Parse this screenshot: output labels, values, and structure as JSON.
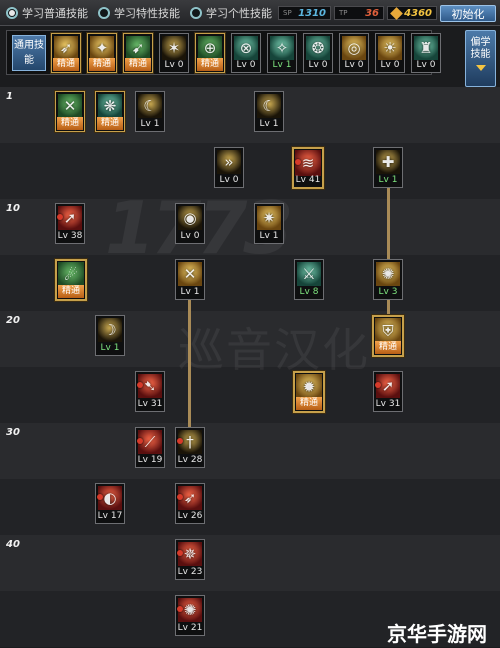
{
  "topbar": {
    "tabs": [
      {
        "label": "学习普通技能",
        "selected": true
      },
      {
        "label": "学习特性技能",
        "selected": false
      },
      {
        "label": "学习个性技能",
        "selected": false
      }
    ],
    "counters": [
      {
        "icon": "sp-icon",
        "value": "1310"
      },
      {
        "icon": "tp-icon",
        "value": "36"
      },
      {
        "icon": "qp-gem-icon",
        "value": "4360"
      }
    ],
    "reset_label": "初始化"
  },
  "common_skills": {
    "label": "通用技能",
    "slots": [
      {
        "text": "精通",
        "mastery": true,
        "glyph": "➶",
        "tone": "t-gold"
      },
      {
        "text": "精通",
        "mastery": true,
        "glyph": "✦",
        "tone": "t-gold"
      },
      {
        "text": "精通",
        "mastery": true,
        "glyph": "➹",
        "tone": "t-green"
      },
      {
        "text": "Lv 0",
        "mastery": false,
        "glyph": "✶",
        "tone": "t-dark"
      },
      {
        "text": "精通",
        "mastery": true,
        "glyph": "⊕",
        "tone": "t-green"
      },
      {
        "text": "Lv 0",
        "mastery": false,
        "glyph": "⊗",
        "tone": "t-teal"
      },
      {
        "text": "Lv 1",
        "mastery": false,
        "glyph": "✧",
        "tone": "t-teal",
        "green": true
      },
      {
        "text": "Lv 0",
        "mastery": false,
        "glyph": "❂",
        "tone": "t-teal"
      },
      {
        "text": "Lv 0",
        "mastery": false,
        "glyph": "◎",
        "tone": "t-gold"
      },
      {
        "text": "Lv 0",
        "mastery": false,
        "glyph": "☀",
        "tone": "t-gold"
      },
      {
        "text": "Lv 0",
        "mastery": false,
        "glyph": "♜",
        "tone": "t-teal"
      }
    ]
  },
  "learn_panel": {
    "label": "偏学技能"
  },
  "levels": [
    "1",
    "10",
    "20",
    "30",
    "40"
  ],
  "watermarks": {
    "number": "1773",
    "group": "巡音汉化"
  },
  "brand": "京华手游网",
  "tree": [
    {
      "id": "s1",
      "text": "精通",
      "mastery": true,
      "glyph": "✕",
      "tone": "t-green"
    },
    {
      "id": "s2",
      "text": "精通",
      "mastery": true,
      "glyph": "❋",
      "tone": "t-teal"
    },
    {
      "id": "s3",
      "text": "Lv 1",
      "glyph": "☾",
      "tone": "t-dark"
    },
    {
      "id": "s4",
      "text": "Lv 1",
      "glyph": "☾",
      "tone": "t-dark"
    },
    {
      "id": "s5",
      "text": "Lv 0",
      "glyph": "»",
      "tone": "t-dark"
    },
    {
      "id": "s6",
      "text": "Lv 41",
      "glyph": "≋",
      "tone": "t-red",
      "active": true,
      "lock": true
    },
    {
      "id": "s7",
      "text": "Lv 1",
      "glyph": "✚",
      "tone": "t-dark",
      "green": true
    },
    {
      "id": "s8",
      "text": "Lv 38",
      "glyph": "➚",
      "tone": "t-red",
      "lock": true
    },
    {
      "id": "s9",
      "text": "Lv 0",
      "glyph": "◉",
      "tone": "t-dark"
    },
    {
      "id": "s10",
      "text": "Lv 1",
      "glyph": "✷",
      "tone": "t-gold"
    },
    {
      "id": "s11",
      "text": "精通",
      "mastery": true,
      "glyph": "☄",
      "tone": "t-green"
    },
    {
      "id": "s12",
      "text": "Lv 1",
      "glyph": "✕",
      "tone": "t-gold"
    },
    {
      "id": "s13",
      "text": "Lv 8",
      "glyph": "⚔",
      "tone": "t-teal",
      "green": true
    },
    {
      "id": "s14",
      "text": "Lv 3",
      "glyph": "✺",
      "tone": "t-gold",
      "green": true
    },
    {
      "id": "s15",
      "text": "Lv 1",
      "glyph": "☽",
      "tone": "t-dark",
      "green": true
    },
    {
      "id": "s16",
      "text": "精通",
      "mastery": true,
      "glyph": "⛨",
      "tone": "t-gold"
    },
    {
      "id": "s17",
      "text": "Lv 31",
      "glyph": "➷",
      "tone": "t-red",
      "lock": true
    },
    {
      "id": "s18",
      "text": "精通",
      "mastery": true,
      "glyph": "✹",
      "tone": "t-gold"
    },
    {
      "id": "s19",
      "text": "Lv 31",
      "glyph": "➚",
      "tone": "t-red",
      "lock": true
    },
    {
      "id": "s20",
      "text": "Lv 19",
      "glyph": "⟋",
      "tone": "t-red",
      "lock": true
    },
    {
      "id": "s21",
      "text": "Lv 28",
      "glyph": "†",
      "tone": "t-dark",
      "lock": true
    },
    {
      "id": "s22",
      "text": "Lv 17",
      "glyph": "◐",
      "tone": "t-red",
      "lock": true
    },
    {
      "id": "s23",
      "text": "Lv 26",
      "glyph": "➶",
      "tone": "t-red",
      "lock": true
    },
    {
      "id": "s24",
      "text": "Lv 23",
      "glyph": "✵",
      "tone": "t-red",
      "lock": true
    },
    {
      "id": "s25",
      "text": "Lv 21",
      "glyph": "✺",
      "tone": "t-red",
      "lock": true
    }
  ],
  "colors": {
    "accent_blue": "#4d79a8",
    "gold_frame": "#c6a04b",
    "mastery_orange": "#e08a30",
    "level_green": "#7ee37e"
  }
}
